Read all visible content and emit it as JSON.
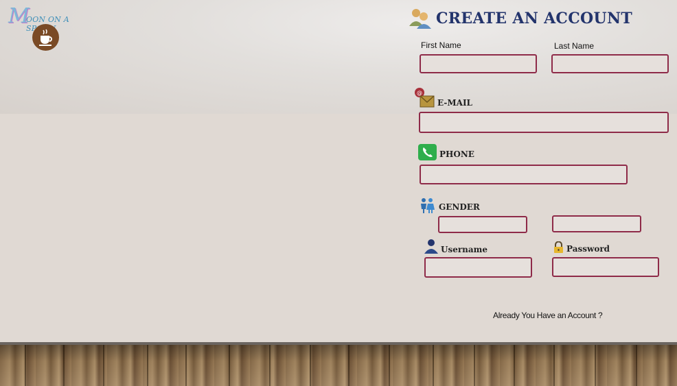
{
  "brand": {
    "logo_letter": "M",
    "logo_text": "OON ON A SPOON"
  },
  "form": {
    "title": "CREATE AN ACCOUNT",
    "first_name_label": "First Name",
    "last_name_label": "Last Name",
    "email_label": "E-MAIL",
    "phone_label": "PHONE",
    "gender_label": "GENDER",
    "username_label": "Username",
    "password_label": "Password",
    "first_name_value": "",
    "last_name_value": "",
    "email_value": "",
    "phone_value": "",
    "gender_value_1": "",
    "gender_value_2": "",
    "username_value": "",
    "password_value": "",
    "login_link": "Already You Have an Account ?"
  },
  "icons": [
    "coffee-cup-icon",
    "users-icon",
    "email-envelope-icon",
    "phone-icon",
    "gender-people-icon",
    "user-icon",
    "padlock-icon"
  ],
  "colors": {
    "title": "#23346c",
    "field_border": "#8e2a48",
    "wall": "#e0d9d3",
    "floor": "#9c7d57"
  }
}
